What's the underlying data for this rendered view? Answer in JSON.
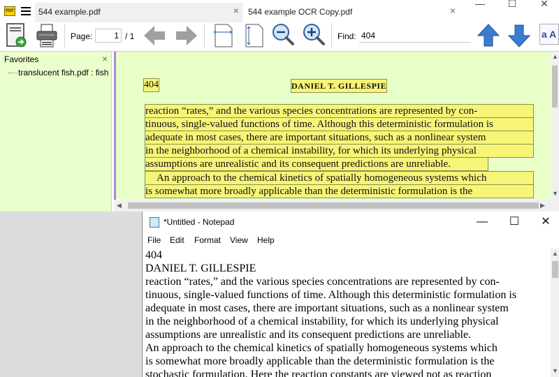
{
  "pdf_viewer": {
    "tabs": [
      {
        "label": "544 example.pdf",
        "close": "×"
      },
      {
        "label": "544 example OCR Copy.pdf",
        "close": "×"
      }
    ],
    "window_controls": {
      "minimize": "—",
      "maximize": "☐",
      "close": "✕"
    },
    "toolbar": {
      "page_label": "Page:",
      "page_value": "1",
      "page_total": "/ 1",
      "find_label": "Find:",
      "find_value": "404",
      "font_icon_text": "a A"
    },
    "favorites": {
      "title": "Favorites",
      "close": "×",
      "items": [
        "translucent fish.pdf : fish"
      ]
    },
    "document": {
      "page_number": "404",
      "running_head": "DANIEL T. GILLESPIE",
      "lines": [
        "reaction “rates,” and the various species concentrations are represented by con-",
        "tinuous, single-valued functions of time. Although this deterministic formulation is",
        "adequate in most cases, there are important situations, such as a nonlinear system",
        "in the neighborhood of a chemical instability, for which its underlying physical",
        "assumptions are unrealistic and its consequent predictions are unreliable.",
        "An approach to the chemical kinetics of spatially homogeneous systems which",
        "is somewhat more broadly applicable than the deterministic formulation is the"
      ]
    },
    "colors": {
      "doc_background": "#e8ffc8",
      "favorites_background": "#ebffcc",
      "highlight": "#f6f578",
      "accent": "#a98ad8"
    }
  },
  "notepad": {
    "title": "*Untitled - Notepad",
    "controls": {
      "minimize": "—",
      "maximize": "☐",
      "close": "✕"
    },
    "menu": [
      "File",
      "Edit",
      "Format",
      "View",
      "Help"
    ],
    "lines": [
      "404",
      "DANIEL T. GILLESPIE",
      "reaction “rates,” and the various species concentrations are represented by con-",
      "tinuous, single-valued functions of time. Although this deterministic formulation is",
      "adequate in most cases, there are important situations, such as a nonlinear system",
      "in the neighborhood of a chemical instability, for which its underlying physical",
      "assumptions are unrealistic and its consequent predictions are unreliable.",
      "An approach to the chemical kinetics of spatially homogeneous systems which",
      "is somewhat more broadly applicable than the deterministic formulation is the",
      "stochastic formulation. Here the reaction constants are viewed not as reaction"
    ]
  }
}
